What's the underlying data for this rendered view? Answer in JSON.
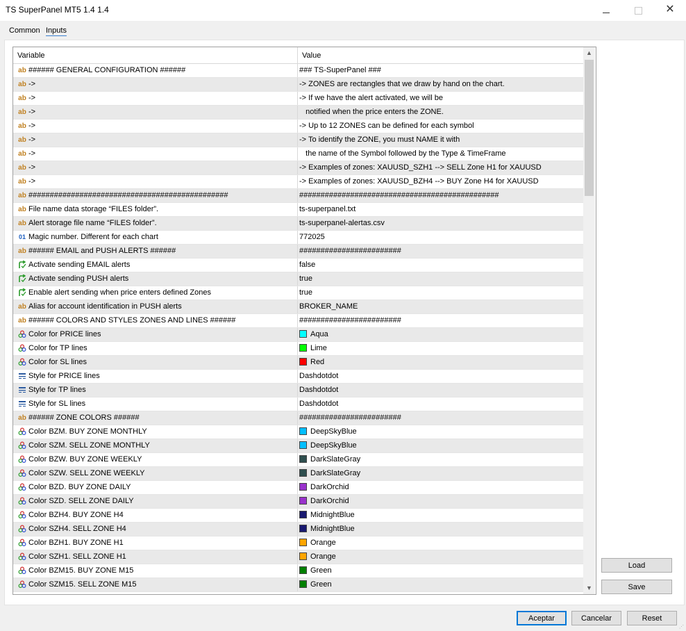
{
  "window": {
    "title": "TS SuperPanel MT5 1.4 1.4"
  },
  "tabs": [
    {
      "label": "Common",
      "active": false
    },
    {
      "label": "Inputs",
      "active": true
    }
  ],
  "table": {
    "headers": {
      "variable": "Variable",
      "value": "Value"
    },
    "rows": [
      {
        "type": "ab",
        "variable": "###### GENERAL CONFIGURATION ######",
        "value": "### TS-SuperPanel ###"
      },
      {
        "type": "ab",
        "variable": "->",
        "value": "-> ZONES are rectangles that we draw by hand on the chart."
      },
      {
        "type": "ab",
        "variable": "->",
        "value": "-> If we have the alert activated, we will be"
      },
      {
        "type": "ab",
        "variable": "->",
        "value": "   notified when the price enters the ZONE."
      },
      {
        "type": "ab",
        "variable": "->",
        "value": "-> Up to 12 ZONES can be defined for each symbol"
      },
      {
        "type": "ab",
        "variable": "->",
        "value": "-> To identify the ZONE, you must NAME it with"
      },
      {
        "type": "ab",
        "variable": "->",
        "value": "   the name of the Symbol followed by the Type & TimeFrame"
      },
      {
        "type": "ab",
        "variable": "->",
        "value": "-> Examples of zones: XAUUSD_SZH1 --> SELL Zone H1 for XAUUSD"
      },
      {
        "type": "ab",
        "variable": "->",
        "value": "-> Examples of zones: XAUUSD_BZH4 --> BUY Zone H4 for XAUUSD"
      },
      {
        "type": "ab",
        "variable": "###############################################",
        "value": "###############################################"
      },
      {
        "type": "ab",
        "variable": "File name data storage “FILES folder”.",
        "value": "ts-superpanel.txt"
      },
      {
        "type": "ab",
        "variable": "Alert storage file name “FILES folder”.",
        "value": "ts-superpanel-alertas.csv"
      },
      {
        "type": "num",
        "variable": "Magic number. Different for each chart",
        "value": "772025"
      },
      {
        "type": "ab",
        "variable": "###### EMAIL and PUSH ALERTS ######",
        "value": "########################"
      },
      {
        "type": "bool",
        "variable": "Activate sending EMAIL alerts",
        "value": "false"
      },
      {
        "type": "bool",
        "variable": "Activate sending PUSH alerts",
        "value": "true"
      },
      {
        "type": "bool",
        "variable": "Enable alert sending when price enters defined Zones",
        "value": "true"
      },
      {
        "type": "ab",
        "variable": "Alias for account identification in PUSH alerts",
        "value": "BROKER_NAME"
      },
      {
        "type": "ab",
        "variable": "###### COLORS AND STYLES ZONES AND LINES ######",
        "value": "########################"
      },
      {
        "type": "color",
        "variable": "Color for PRICE lines",
        "value": "Aqua",
        "swatch": "#00ffff"
      },
      {
        "type": "color",
        "variable": "Color for TP lines",
        "value": "Lime",
        "swatch": "#00ff00"
      },
      {
        "type": "color",
        "variable": "Color for SL lines",
        "value": "Red",
        "swatch": "#ff0000"
      },
      {
        "type": "style",
        "variable": "Style for PRICE lines",
        "value": "Dashdotdot"
      },
      {
        "type": "style",
        "variable": "Style for TP lines",
        "value": "Dashdotdot"
      },
      {
        "type": "style",
        "variable": "Style for SL lines",
        "value": "Dashdotdot"
      },
      {
        "type": "ab",
        "variable": "###### ZONE COLORS ######",
        "value": "########################"
      },
      {
        "type": "color",
        "variable": "Color BZM. BUY ZONE MONTHLY",
        "value": "DeepSkyBlue",
        "swatch": "#00bfff"
      },
      {
        "type": "color",
        "variable": "Color SZM. SELL ZONE MONTHLY",
        "value": "DeepSkyBlue",
        "swatch": "#00bfff"
      },
      {
        "type": "color",
        "variable": "Color BZW. BUY ZONE WEEKLY",
        "value": "DarkSlateGray",
        "swatch": "#2f4f4f"
      },
      {
        "type": "color",
        "variable": "Color SZW. SELL ZONE WEEKLY",
        "value": "DarkSlateGray",
        "swatch": "#2f4f4f"
      },
      {
        "type": "color",
        "variable": "Color BZD. BUY ZONE DAILY",
        "value": "DarkOrchid",
        "swatch": "#9932cc"
      },
      {
        "type": "color",
        "variable": "Color SZD. SELL ZONE DAILY",
        "value": "DarkOrchid",
        "swatch": "#9932cc"
      },
      {
        "type": "color",
        "variable": "Color BZH4. BUY ZONE H4",
        "value": "MidnightBlue",
        "swatch": "#191970"
      },
      {
        "type": "color",
        "variable": "Color SZH4. SELL ZONE H4",
        "value": "MidnightBlue",
        "swatch": "#191970"
      },
      {
        "type": "color",
        "variable": "Color BZH1. BUY ZONE H1",
        "value": "Orange",
        "swatch": "#ffa500"
      },
      {
        "type": "color",
        "variable": "Color SZH1. SELL ZONE H1",
        "value": "Orange",
        "swatch": "#ffa500"
      },
      {
        "type": "color",
        "variable": "Color BZM15. BUY ZONE M15",
        "value": "Green",
        "swatch": "#008000"
      },
      {
        "type": "color",
        "variable": "Color SZM15. SELL ZONE M15",
        "value": "Green",
        "swatch": "#008000"
      }
    ]
  },
  "side_buttons": {
    "load": "Load",
    "save": "Save"
  },
  "bottom_buttons": {
    "ok": "Aceptar",
    "cancel": "Cancelar",
    "reset": "Reset"
  },
  "icons": {
    "ab": "ab",
    "num": "01",
    "bool": "bool-arrow-icon",
    "color": "color-dots-icon",
    "style": "line-style-icon"
  }
}
